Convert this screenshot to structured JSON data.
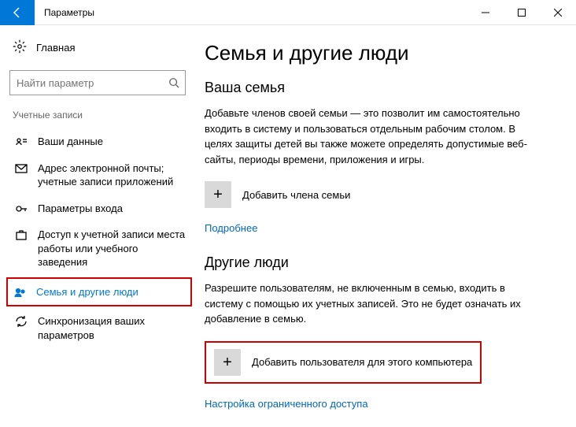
{
  "titlebar": {
    "title": "Параметры"
  },
  "sidebar": {
    "home": "Главная",
    "searchPlaceholder": "Найти параметр",
    "section": "Учетные записи",
    "items": [
      {
        "label": "Ваши данные"
      },
      {
        "label": "Адрес электронной почты; учетные записи приложений"
      },
      {
        "label": "Параметры входа"
      },
      {
        "label": "Доступ к учетной записи места работы или учебного заведения"
      },
      {
        "label": "Семья и другие люди"
      },
      {
        "label": "Синхронизация ваших параметров"
      }
    ]
  },
  "content": {
    "heading": "Семья и другие люди",
    "family": {
      "title": "Ваша семья",
      "desc": "Добавьте членов своей семьи — это позволит им самостоятельно входить в систему и пользоваться отдельным рабочим столом. В целях защиты детей вы также можете определять допустимые веб-сайты, периоды времени, приложения и игры.",
      "addLabel": "Добавить члена семьи",
      "moreLink": "Подробнее"
    },
    "other": {
      "title": "Другие люди",
      "desc": "Разрешите пользователям, не включенным в семью, входить в систему с помощью их учетных записей. Это не будет означать их добавление в семью.",
      "addLabel": "Добавить пользователя для этого компьютера",
      "kioskLink": "Настройка ограниченного доступа"
    }
  }
}
